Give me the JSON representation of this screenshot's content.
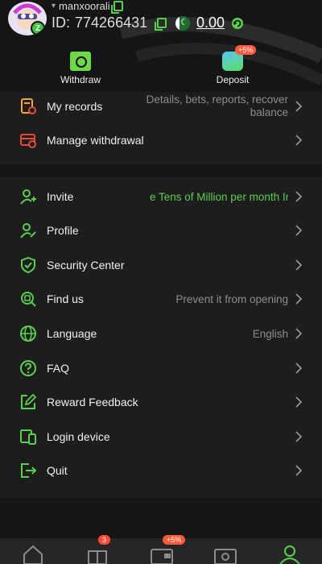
{
  "user": {
    "username": "manxoorali",
    "id_label": "ID:",
    "id_value": "774266431",
    "balance": "0.00",
    "avatar_badge": "Z"
  },
  "quick_actions": {
    "withdraw": "Withdraw",
    "deposit": "Deposit",
    "deposit_badge": "+5%"
  },
  "section1": [
    {
      "label": "My records",
      "value_line1": "Details, bets, reports, recover",
      "value_line2": "balance",
      "icon": "records-icon"
    },
    {
      "label": "Manage withdrawal",
      "value": "",
      "icon": "withdrawal-card-icon"
    }
  ],
  "section2": [
    {
      "label": "Invite",
      "value": "e Tens of Million per month  Inc",
      "icon": "invite-user-icon"
    },
    {
      "label": "Profile",
      "value": "",
      "icon": "profile-icon"
    },
    {
      "label": "Security Center",
      "value": "",
      "icon": "shield-icon"
    },
    {
      "label": "Find us",
      "value": "Prevent it from opening",
      "icon": "find-search-icon"
    },
    {
      "label": "Language",
      "value": "English",
      "icon": "globe-icon"
    },
    {
      "label": "FAQ",
      "value": "",
      "icon": "question-icon"
    },
    {
      "label": "Reward Feedback",
      "value": "",
      "icon": "edit-feedback-icon"
    },
    {
      "label": "Login device",
      "value": "",
      "icon": "device-icon"
    },
    {
      "label": "Quit",
      "value": "",
      "icon": "logout-icon"
    }
  ],
  "bottom_nav": {
    "gift_badge": "3",
    "wallet_badge": "+5%"
  },
  "colors": {
    "accent": "#58d04d",
    "background": "#151515",
    "panel": "#1d1d1d",
    "muted_text": "#8c8c8c",
    "badge_red": "#ff4a3a"
  }
}
